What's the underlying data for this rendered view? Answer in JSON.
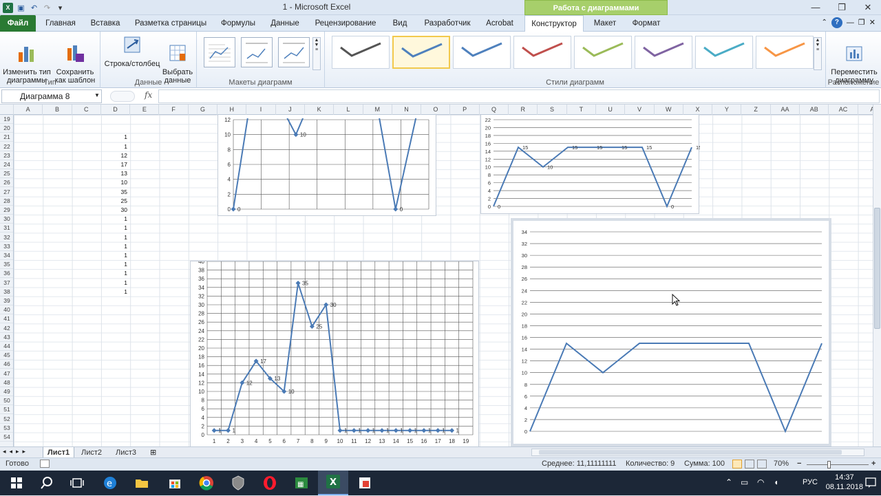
{
  "window": {
    "title": "1  -  Microsoft Excel",
    "context_tab": "Работа с диаграммами"
  },
  "tabs": {
    "file": "Файл",
    "items": [
      "Главная",
      "Вставка",
      "Разметка страницы",
      "Формулы",
      "Данные",
      "Рецензирование",
      "Вид",
      "Разработчик",
      "Acrobat",
      "Конструктор",
      "Макет",
      "Формат"
    ]
  },
  "ribbon": {
    "change_type": "Изменить тип\nдиаграммы",
    "save_template": "Сохранить\nкак шаблон",
    "group_type": "Тип",
    "row_col": "Строка/столбец",
    "select_data": "Выбрать\nданные",
    "group_data": "Данные",
    "group_layouts": "Макеты диаграмм",
    "group_styles": "Стили диаграмм",
    "move_chart": "Переместить\nдиаграмму",
    "group_location": "Расположение",
    "style_colors": [
      "#555555",
      "#4f81bd",
      "#4f81bd",
      "#c0504d",
      "#9bbb59",
      "#8064a2",
      "#4bacc6",
      "#f79646"
    ]
  },
  "formula_bar": {
    "name_box": "Диаграмма 8",
    "fx": "fx",
    "value": ""
  },
  "columns": [
    "A",
    "B",
    "C",
    "D",
    "E",
    "F",
    "G",
    "H",
    "I",
    "J",
    "K",
    "L",
    "M",
    "N",
    "O",
    "P",
    "Q",
    "R",
    "S",
    "T",
    "U",
    "V",
    "W",
    "X",
    "Y",
    "Z",
    "AA",
    "AB",
    "AC",
    "A"
  ],
  "rows": [
    "19",
    "20",
    "21",
    "22",
    "23",
    "24",
    "25",
    "26",
    "27",
    "28",
    "29",
    "30",
    "31",
    "32",
    "33",
    "34",
    "35",
    "36",
    "37",
    "38",
    "39",
    "40",
    "41",
    "42",
    "43",
    "44",
    "45",
    "46",
    "47",
    "48",
    "49",
    "50",
    "51",
    "52",
    "53",
    "54"
  ],
  "cells_d": [
    "",
    "",
    "1",
    "1",
    "12",
    "17",
    "13",
    "10",
    "35",
    "25",
    "30",
    "1",
    "1",
    "1",
    "1",
    "1",
    "1",
    "1",
    "1",
    "1"
  ],
  "charts": [
    {
      "id": "chart-top-left",
      "type": "line",
      "ylim": [
        0,
        12
      ],
      "yticks": [
        0,
        2,
        4,
        6,
        8,
        10,
        12
      ],
      "marker": "diamond",
      "points": [
        [
          0,
          0
        ],
        [
          0.12,
          20
        ],
        [
          0.32,
          10
        ],
        [
          0.45,
          18
        ],
        [
          0.55,
          25
        ],
        [
          0.66,
          25
        ],
        [
          0.83,
          0
        ],
        [
          1,
          20
        ]
      ],
      "labels": [
        {
          "i": 0,
          "t": "0"
        },
        {
          "i": 2,
          "t": "10"
        },
        {
          "i": 6,
          "t": "0"
        }
      ],
      "vgrid": true
    },
    {
      "id": "chart-top-right",
      "type": "line",
      "ylim": [
        0,
        22
      ],
      "yticks": [
        0,
        2,
        4,
        6,
        8,
        10,
        12,
        14,
        16,
        18,
        20,
        22
      ],
      "marker": "none",
      "points": [
        [
          1,
          0
        ],
        [
          2,
          15
        ],
        [
          3,
          10
        ],
        [
          4,
          15
        ],
        [
          5,
          15
        ],
        [
          6,
          15
        ],
        [
          7,
          15
        ],
        [
          8,
          0
        ],
        [
          9,
          15
        ]
      ],
      "labels": [
        {
          "i": 0,
          "t": "0"
        },
        {
          "i": 1,
          "t": "15"
        },
        {
          "i": 2,
          "t": "10"
        },
        {
          "i": 3,
          "t": "15"
        },
        {
          "i": 4,
          "t": "15"
        },
        {
          "i": 5,
          "t": "15"
        },
        {
          "i": 6,
          "t": "15"
        },
        {
          "i": 7,
          "t": "0"
        },
        {
          "i": 8,
          "t": "15"
        }
      ],
      "vgrid": false
    },
    {
      "id": "chart-bottom-left",
      "type": "line",
      "ylim": [
        0,
        40
      ],
      "yticks": [
        0,
        2,
        4,
        6,
        8,
        10,
        12,
        14,
        16,
        18,
        20,
        22,
        24,
        26,
        28,
        30,
        32,
        34,
        36,
        38,
        40
      ],
      "xticks": [
        "1",
        "2",
        "3",
        "4",
        "5",
        "6",
        "7",
        "8",
        "9",
        "10",
        "11",
        "12",
        "13",
        "14",
        "15",
        "16",
        "17",
        "18",
        "19"
      ],
      "marker": "diamond",
      "points": [
        [
          1,
          1
        ],
        [
          2,
          1
        ],
        [
          3,
          12
        ],
        [
          4,
          17
        ],
        [
          5,
          13
        ],
        [
          6,
          10
        ],
        [
          7,
          35
        ],
        [
          8,
          25
        ],
        [
          9,
          30
        ],
        [
          10,
          1
        ],
        [
          11,
          1
        ],
        [
          12,
          1
        ],
        [
          13,
          1
        ],
        [
          14,
          1
        ],
        [
          15,
          1
        ],
        [
          16,
          1
        ],
        [
          17,
          1
        ],
        [
          18,
          1
        ]
      ],
      "labels": [
        {
          "i": 0,
          "t": "1"
        },
        {
          "i": 1,
          "t": "1"
        },
        {
          "i": 2,
          "t": "12"
        },
        {
          "i": 3,
          "t": "17"
        },
        {
          "i": 4,
          "t": "13"
        },
        {
          "i": 5,
          "t": "10"
        },
        {
          "i": 6,
          "t": "35"
        },
        {
          "i": 7,
          "t": "25"
        },
        {
          "i": 8,
          "t": "30"
        },
        {
          "i": 9,
          "t": "1"
        },
        {
          "i": 10,
          "t": "1"
        },
        {
          "i": 11,
          "t": "1"
        },
        {
          "i": 12,
          "t": "1"
        },
        {
          "i": 13,
          "t": "1"
        },
        {
          "i": 14,
          "t": "1"
        },
        {
          "i": 15,
          "t": "1"
        },
        {
          "i": 16,
          "t": "1"
        },
        {
          "i": 17,
          "t": "1"
        }
      ],
      "vgrid": true
    },
    {
      "id": "chart-selected",
      "type": "line",
      "ylim": [
        0,
        34
      ],
      "yticks": [
        0,
        2,
        4,
        6,
        8,
        10,
        12,
        14,
        16,
        18,
        20,
        22,
        24,
        26,
        28,
        30,
        32,
        34
      ],
      "marker": "none",
      "points": [
        [
          1,
          0
        ],
        [
          2,
          15
        ],
        [
          3,
          10
        ],
        [
          4,
          15
        ],
        [
          5,
          15
        ],
        [
          6,
          15
        ],
        [
          7,
          15
        ],
        [
          8,
          0
        ],
        [
          9,
          15
        ]
      ],
      "labels": [],
      "vgrid": false
    }
  ],
  "sheets": [
    "Лист1",
    "Лист2",
    "Лист3"
  ],
  "status": {
    "ready": "Готово",
    "average": "Среднее: 11,11111111",
    "count": "Количество: 9",
    "sum": "Сумма: 100",
    "zoom": "70%"
  },
  "taskbar": {
    "lang": "РУС",
    "time": "14:37",
    "date": "08.11.2018"
  }
}
